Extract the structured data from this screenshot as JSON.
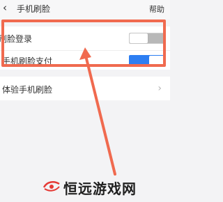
{
  "nav": {
    "back_icon": "‹",
    "title": "手机刷脸",
    "help": "帮助"
  },
  "settings": {
    "face_login": {
      "label": "刷脸登录",
      "enabled": false
    },
    "face_pay": {
      "label": "手机刷脸支付",
      "enabled": true
    },
    "experience": {
      "label": "体验手机刷脸",
      "chevron": "›"
    }
  },
  "watermark": {
    "text": "恒远游戏网"
  },
  "colors": {
    "highlight": "#f06a4f",
    "toggle_on": "#2d7ef2",
    "toggle_off": "#b8b8b8"
  }
}
